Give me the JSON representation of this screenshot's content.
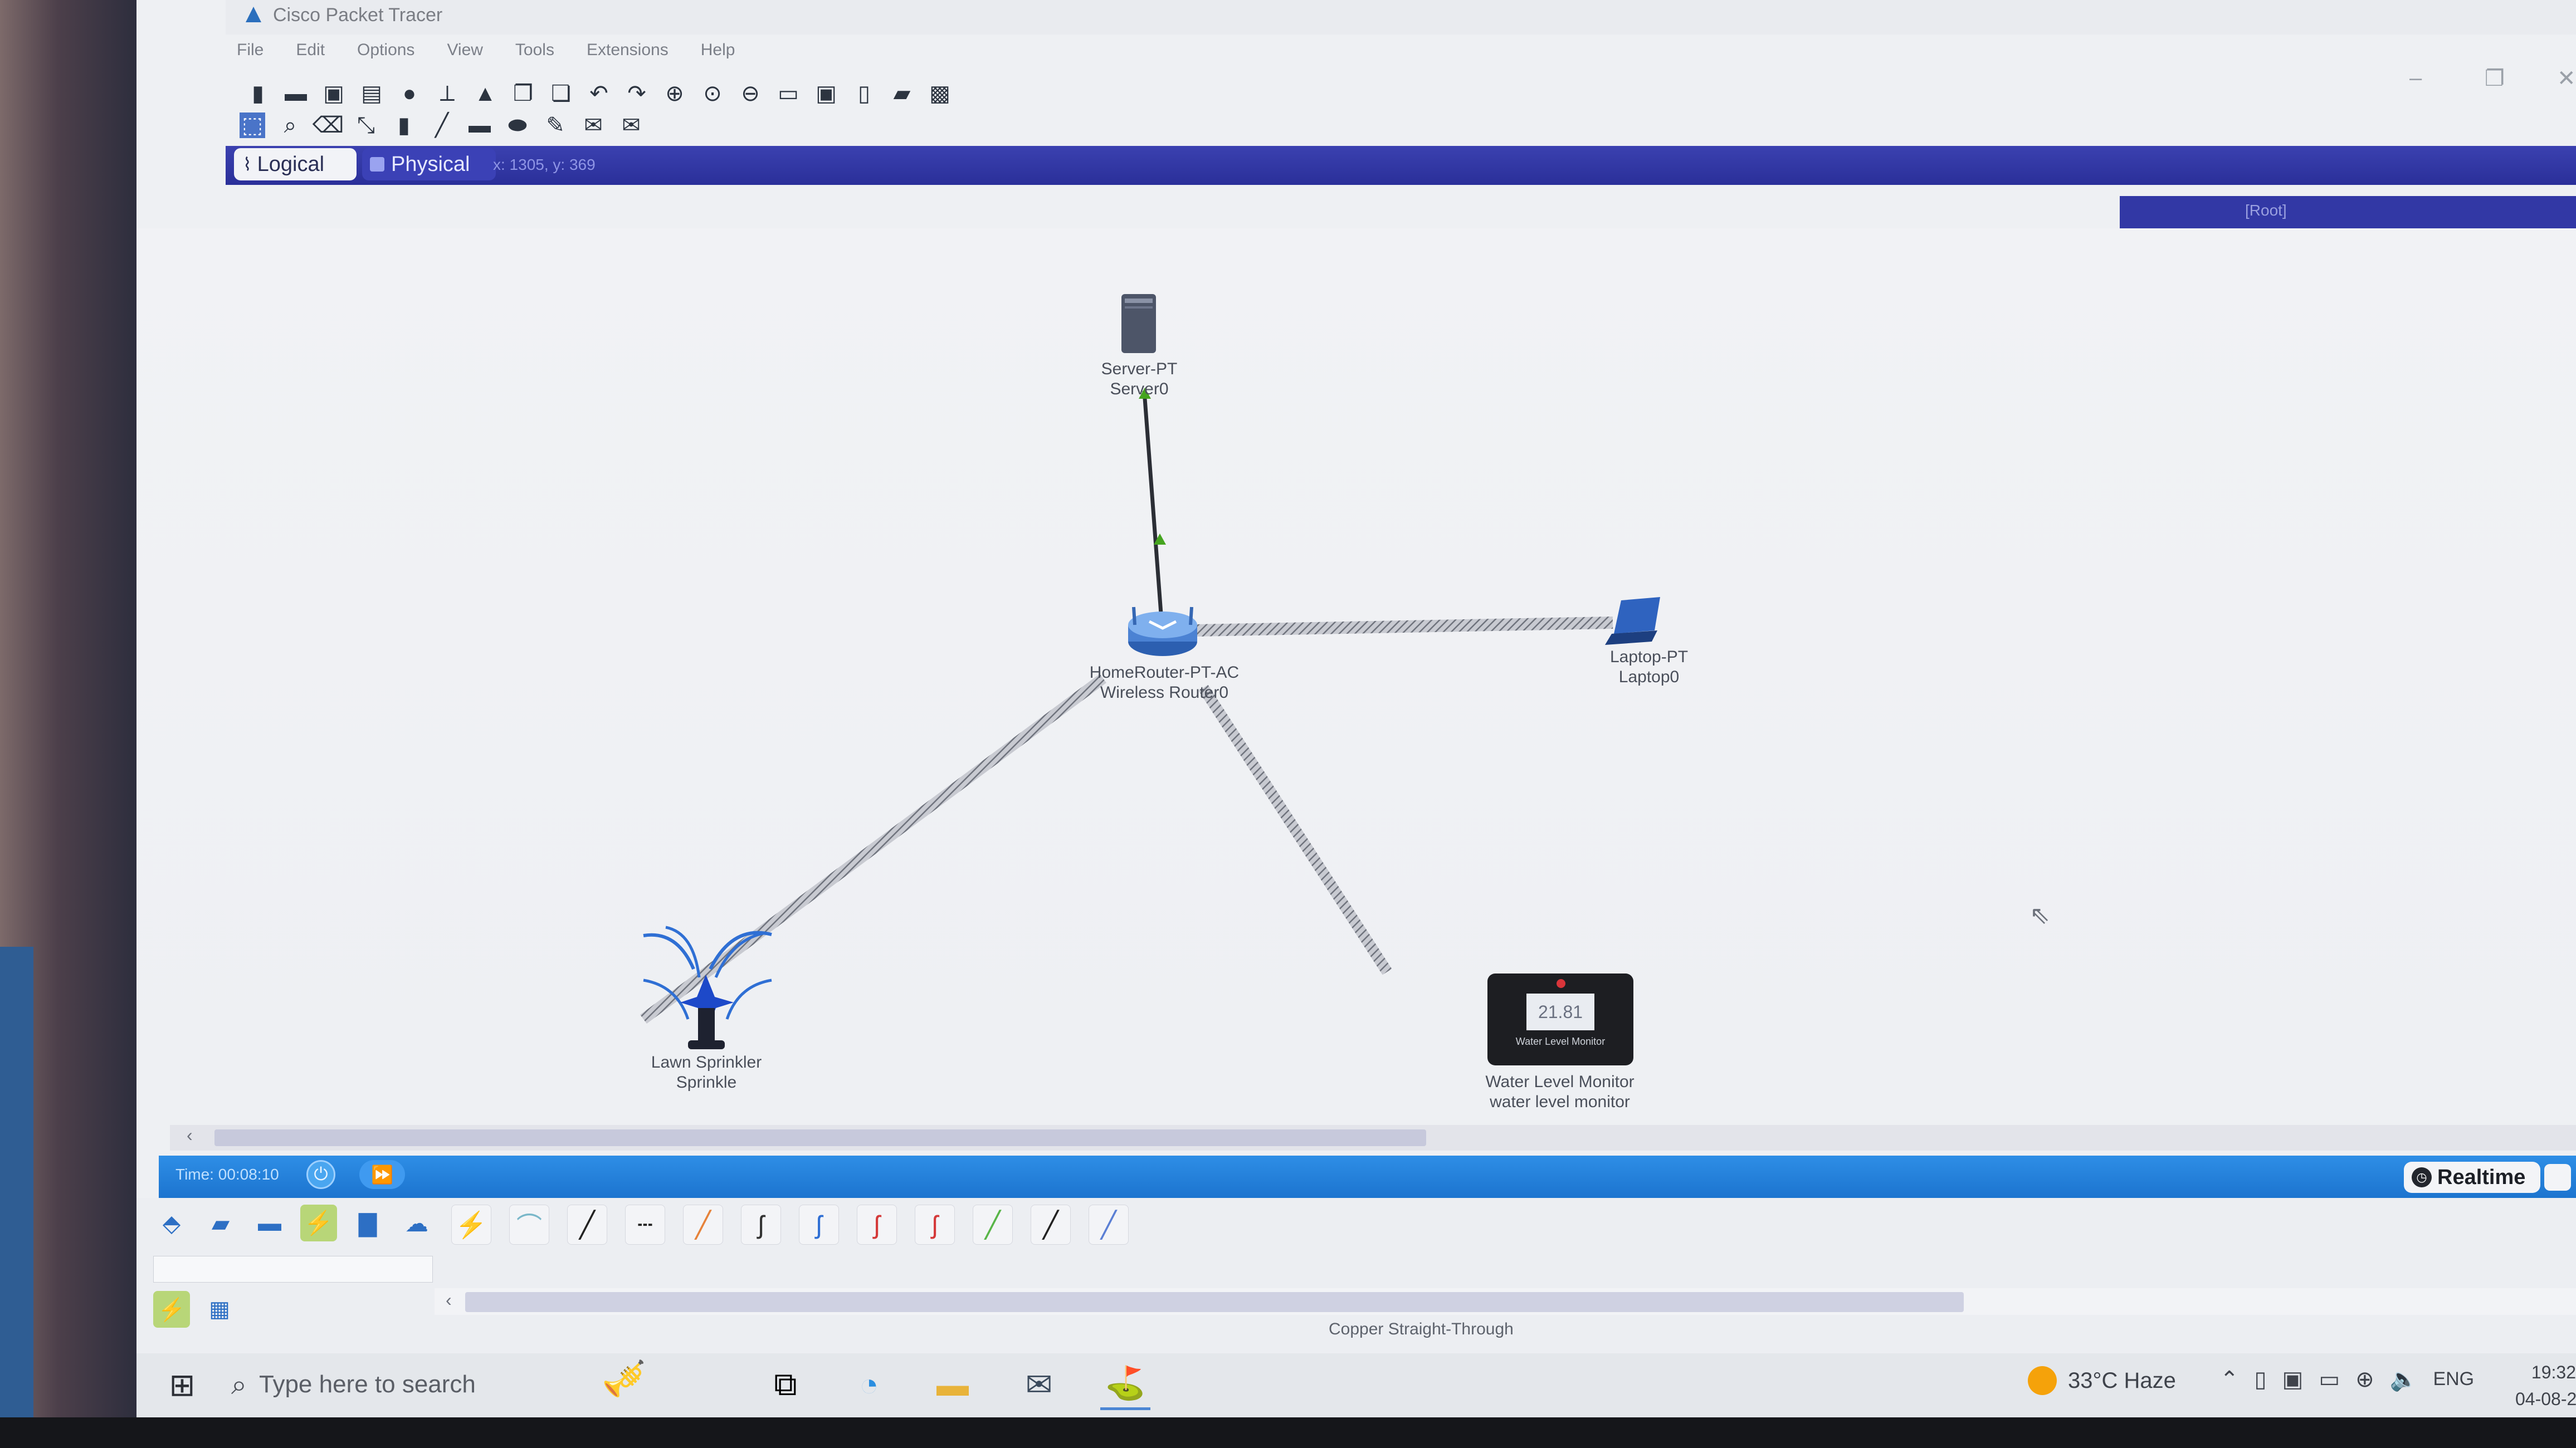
{
  "window": {
    "title": "Cisco Packet Tracer",
    "app_icon": "packet-tracer-icon"
  },
  "menu": [
    "File",
    "Edit",
    "Options",
    "View",
    "Tools",
    "Extensions",
    "Help"
  ],
  "view_tabs": {
    "logical": "Logical",
    "physical": "Physical",
    "coordinates": "x: 1305, y: 369",
    "root": "[Root]"
  },
  "devices": {
    "server": {
      "type": "Server-PT",
      "name": "Server0"
    },
    "router": {
      "type": "HomeRouter-PT-AC",
      "name": "Wireless Router0"
    },
    "laptop": {
      "type": "Laptop-PT",
      "name": "Laptop0"
    },
    "sprinkler": {
      "type": "Lawn Sprinkler",
      "name": "Sprinkle"
    },
    "water_monitor": {
      "type": "Water Level Monitor",
      "name": "water level monitor",
      "reading": "21.81",
      "caption": "Water Level Monitor"
    }
  },
  "simulation": {
    "time": "Time: 00:08:10",
    "realtime_label": "Realtime",
    "mode_icon": "clock-icon"
  },
  "device_panel": {
    "selected_connection": "Copper Straight-Through",
    "categories": [
      "network-devices-icon",
      "end-devices-icon",
      "components-icon",
      "connections-icon",
      "miscellaneous-icon",
      "multiuser-icon"
    ],
    "connection_types": [
      "automatic-connection-icon",
      "console-cable-icon",
      "copper-straight-through-icon",
      "copper-cross-over-icon",
      "fiber-icon",
      "phone-cable-icon",
      "coaxial-icon",
      "serial-dce-icon",
      "serial-dte-icon",
      "octal-cable-icon",
      "iot-custom-cable-icon",
      "usb-cable-icon"
    ]
  },
  "taskbar": {
    "search_placeholder": "Type here to search",
    "weather": "33°C  Haze",
    "language": "ENG",
    "time": "19:32",
    "date": "04-08-2"
  }
}
